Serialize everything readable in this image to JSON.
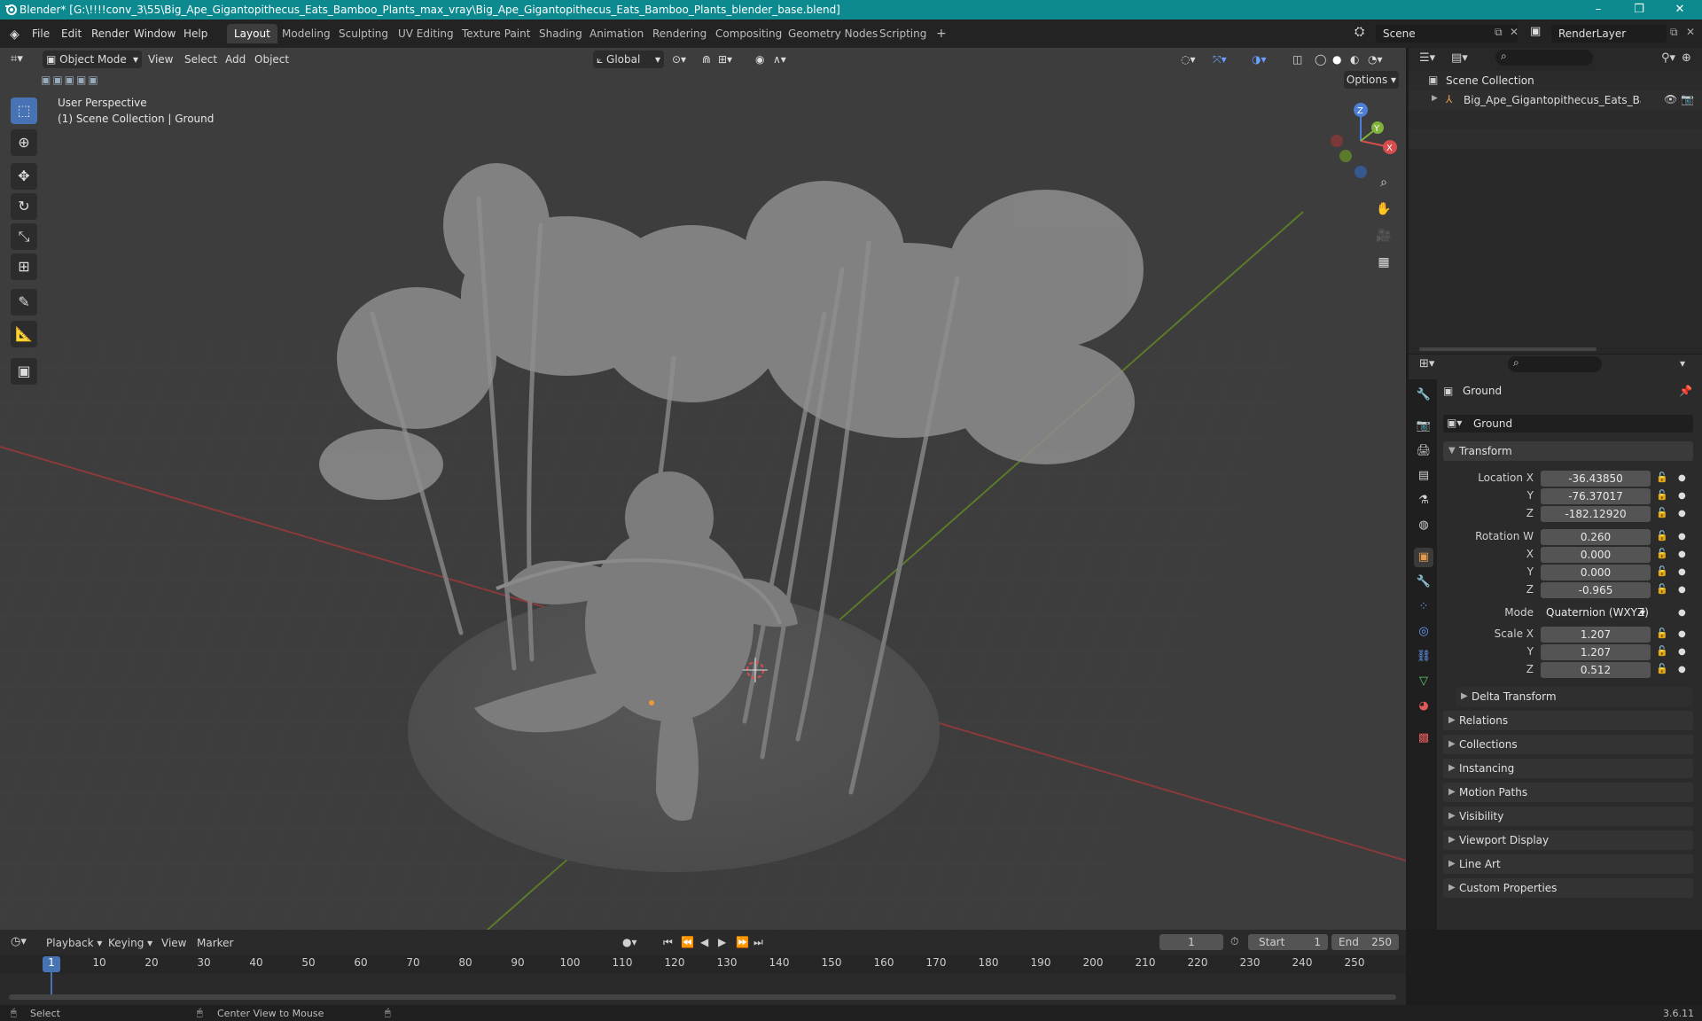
{
  "window": {
    "title": "Blender* [G:\\!!!!conv_3\\55\\Big_Ape_Gigantopithecus_Eats_Bamboo_Plants_max_vray\\Big_Ape_Gigantopithecus_Eats_Bamboo_Plants_blender_base.blend]",
    "minimize": "–",
    "maximize": "❐",
    "close": "✕"
  },
  "menu": [
    "File",
    "Edit",
    "Render",
    "Window",
    "Help"
  ],
  "workspaces": [
    "Layout",
    "Modeling",
    "Sculpting",
    "UV Editing",
    "Texture Paint",
    "Shading",
    "Animation",
    "Rendering",
    "Compositing",
    "Geometry Nodes",
    "Scripting"
  ],
  "workspace_add": "+",
  "scene": {
    "name": "Scene",
    "render_layer": "RenderLayer"
  },
  "viewport_header": {
    "mode": "Object Mode",
    "menus": [
      "View",
      "Select",
      "Add",
      "Object"
    ],
    "orientation": "Global",
    "options": "Options"
  },
  "viewport": {
    "perspective": "User Perspective",
    "collection": "(1) Scene Collection | Ground",
    "gizmo": {
      "z": "Z",
      "y": "Y",
      "x": "X"
    }
  },
  "outliner": {
    "root": "Scene Collection",
    "item": "Big_Ape_Gigantopithecus_Eats_Bamboo"
  },
  "properties": {
    "object_name": "Ground",
    "data_name": "Ground",
    "transform_title": "Transform",
    "location": {
      "label_x": "Location X",
      "x": "-36.43850",
      "label_y": "Y",
      "y": "-76.37017",
      "label_z": "Z",
      "z": "-182.12920"
    },
    "rotation": {
      "label_w": "Rotation W",
      "w": "0.260",
      "label_x": "X",
      "x": "0.000",
      "label_y": "Y",
      "y": "0.000",
      "label_z": "Z",
      "z": "-0.965"
    },
    "mode_label": "Mode",
    "mode_value": "Quaternion (WXYZ)",
    "scale": {
      "label_x": "Scale X",
      "x": "1.207",
      "label_y": "Y",
      "y": "1.207",
      "label_z": "Z",
      "z": "0.512"
    },
    "delta": "Delta Transform",
    "panels": [
      "Relations",
      "Collections",
      "Instancing",
      "Motion Paths",
      "Visibility",
      "Viewport Display",
      "Line Art",
      "Custom Properties"
    ]
  },
  "timeline": {
    "menus": [
      "Playback",
      "Keying",
      "View",
      "Marker"
    ],
    "current_frame": "1",
    "start_label": "Start",
    "start": "1",
    "end_label": "End",
    "end": "250",
    "ticks": [
      "1",
      "10",
      "20",
      "30",
      "40",
      "50",
      "60",
      "70",
      "80",
      "90",
      "100",
      "110",
      "120",
      "130",
      "140",
      "150",
      "160",
      "170",
      "180",
      "190",
      "200",
      "210",
      "220",
      "230",
      "240",
      "250"
    ]
  },
  "statusbar": {
    "select": "Select",
    "center": "Center View to Mouse",
    "version": "3.6.11"
  }
}
